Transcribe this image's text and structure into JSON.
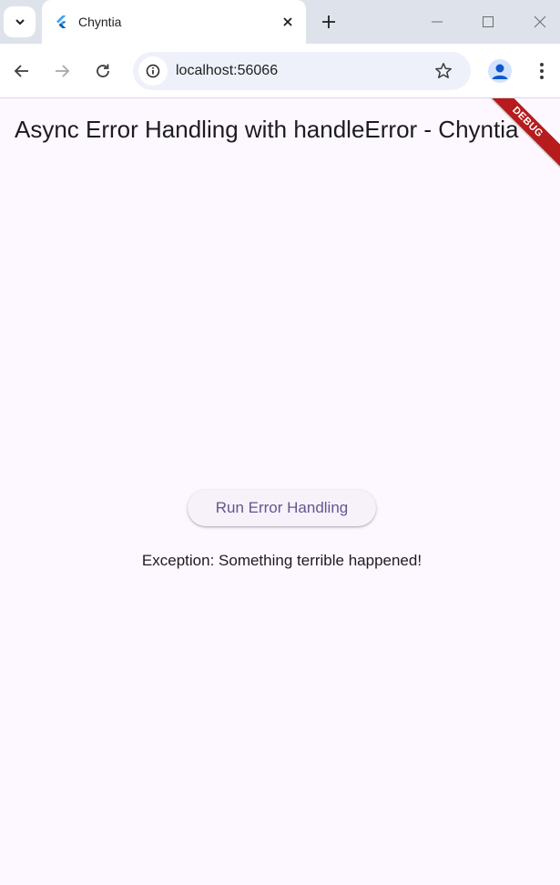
{
  "browser": {
    "tab": {
      "title": "Chyntia",
      "favicon": "flutter-logo-icon"
    },
    "address_bar": {
      "url": "localhost:56066"
    },
    "icons": {
      "tab_search": "chevron-down-icon",
      "close_tab": "close-icon",
      "new_tab": "plus-icon",
      "back": "arrow-left-icon",
      "forward": "arrow-right-icon",
      "reload": "reload-icon",
      "site_info": "info-icon",
      "bookmark": "star-icon",
      "profile": "avatar-icon",
      "menu": "kebab-menu-icon",
      "minimize": "minimize-icon",
      "maximize": "maximize-icon",
      "close_window": "close-icon"
    }
  },
  "app": {
    "title": "Async Error Handling with handleError - Chyntia",
    "debug_banner": "DEBUG",
    "button_label": "Run Error Handling",
    "result": "Exception: Something terrible happened!",
    "colors": {
      "background": "#fdf7ff",
      "button_text": "#65558f",
      "debug_banner": "#b71c1c"
    }
  }
}
